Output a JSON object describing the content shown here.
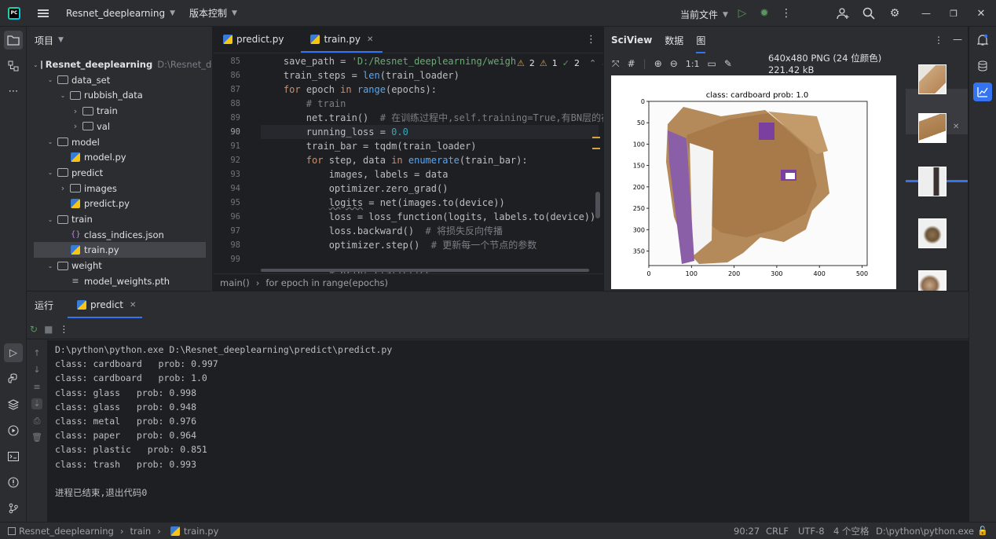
{
  "titlebar": {
    "project": "Resnet_deeplearning",
    "vcs": "版本控制",
    "run_config": "当前文件"
  },
  "project_panel": {
    "title": "项目",
    "tree": [
      {
        "label": "Resnet_deeplearning",
        "suffix": "D:\\Resnet_de",
        "kind": "folder",
        "depth": 0,
        "expanded": true
      },
      {
        "label": "data_set",
        "kind": "folder",
        "depth": 1,
        "expanded": true
      },
      {
        "label": "rubbish_data",
        "kind": "folder",
        "depth": 2,
        "expanded": true
      },
      {
        "label": "train",
        "kind": "folder",
        "depth": 3,
        "expanded": false
      },
      {
        "label": "val",
        "kind": "folder",
        "depth": 3,
        "expanded": false
      },
      {
        "label": "model",
        "kind": "folder",
        "depth": 1,
        "expanded": true
      },
      {
        "label": "model.py",
        "kind": "py",
        "depth": 2
      },
      {
        "label": "predict",
        "kind": "folder",
        "depth": 1,
        "expanded": true
      },
      {
        "label": "images",
        "kind": "folder",
        "depth": 2,
        "expanded": false
      },
      {
        "label": "predict.py",
        "kind": "py",
        "depth": 2
      },
      {
        "label": "train",
        "kind": "folder",
        "depth": 1,
        "expanded": true
      },
      {
        "label": "class_indices.json",
        "kind": "json",
        "depth": 2
      },
      {
        "label": "train.py",
        "kind": "py",
        "depth": 2,
        "selected": true
      },
      {
        "label": "weight",
        "kind": "folder",
        "depth": 1,
        "expanded": true
      },
      {
        "label": "model_weights.pth",
        "kind": "pth",
        "depth": 2
      }
    ]
  },
  "editor": {
    "tabs": [
      {
        "label": "predict.py",
        "active": false
      },
      {
        "label": "train.py",
        "active": true
      }
    ],
    "inspections": {
      "warnings": "2",
      "weak": "1",
      "ok": "2"
    },
    "line_numbers": [
      "85",
      "86",
      "87",
      "88",
      "89",
      "90",
      "91",
      "92",
      "93",
      "94",
      "95",
      "96",
      "97",
      "98",
      "99"
    ],
    "current_line": "90",
    "breadcrumbs": [
      "main()",
      "for epoch in range(epochs)"
    ]
  },
  "sciview": {
    "tabs": [
      "SciView",
      "数据",
      "图"
    ],
    "active_tab": "图",
    "image_info": "640x480 PNG (24 位颜色) 221.42 kB",
    "zoom_label": "1:1",
    "plot": {
      "title": "class: cardboard   prob: 1.0",
      "x_ticks": [
        "0",
        "100",
        "200",
        "300",
        "400",
        "500"
      ],
      "y_ticks": [
        "0",
        "50",
        "100",
        "150",
        "200",
        "250",
        "300",
        "350"
      ]
    }
  },
  "run_panel": {
    "tab_run": "运行",
    "tab_predict": "predict",
    "console": [
      "D:\\python\\python.exe D:\\Resnet_deeplearning\\predict\\predict.py",
      "class: cardboard   prob: 0.997",
      "class: cardboard   prob: 1.0",
      "class: glass   prob: 0.998",
      "class: glass   prob: 0.948",
      "class: metal   prob: 0.976",
      "class: paper   prob: 0.964",
      "class: plastic   prob: 0.851",
      "class: trash   prob: 0.993",
      "",
      "进程已结束,退出代码0"
    ]
  },
  "statusbar": {
    "crumbs": [
      "Resnet_deeplearning",
      "train",
      "train.py"
    ],
    "position": "90:27",
    "line_sep": "CRLF",
    "encoding": "UTF-8",
    "indent": "4 个空格",
    "interpreter": "D:\\python\\python.exe"
  },
  "colors": {
    "accent": "#3574f0",
    "keyword": "#cf8e6d",
    "function": "#56a8f5",
    "string": "#6aab73",
    "number": "#2aacb8",
    "comment": "#7a7e85"
  }
}
